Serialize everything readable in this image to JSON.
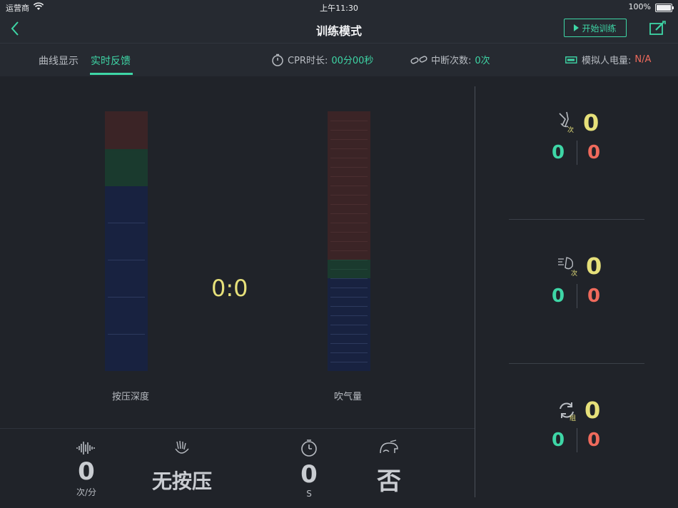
{
  "status_bar": {
    "carrier": "运营商",
    "time": "上午11:30",
    "battery": "100%"
  },
  "nav": {
    "title": "训练模式",
    "start_label": "开始训练"
  },
  "tabs": [
    {
      "label": "曲线显示",
      "active": false
    },
    {
      "label": "实时反馈",
      "active": true
    }
  ],
  "info": {
    "cpr_label": "CPR时长:",
    "cpr_value": "00分00秒",
    "interrupt_label": "中断次数:",
    "interrupt_value": "0次",
    "battery_label": "模拟人电量:",
    "battery_value": "N/A"
  },
  "gauges": {
    "compression_label": "按压深度",
    "breath_label": "吹气量",
    "ratio": "0:0"
  },
  "right_stats": [
    {
      "icon": "compression-count-icon",
      "badge": "次",
      "total": "0",
      "correct": "0",
      "wrong": "0"
    },
    {
      "icon": "breath-count-icon",
      "badge": "次",
      "total": "0",
      "correct": "0",
      "wrong": "0"
    },
    {
      "icon": "cycle-group-icon",
      "badge": "组",
      "total": "0",
      "correct": "0",
      "wrong": "0"
    }
  ],
  "bottom": {
    "rate_value": "0",
    "rate_unit": "次/分",
    "compression_status": "无按压",
    "duration_value": "0",
    "duration_unit": "S",
    "airway_status": "否"
  },
  "colors": {
    "accent": "#3ed6a6",
    "warning": "#ef6a5c",
    "highlight": "#e6e07a"
  }
}
